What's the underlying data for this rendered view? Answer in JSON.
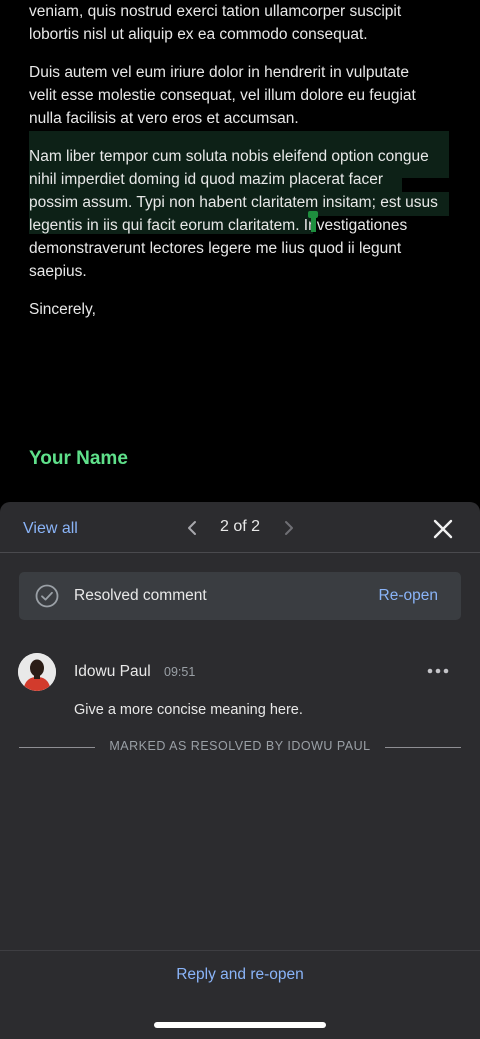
{
  "document": {
    "paragraphs": [
      [
        "veniam, quis nostrud exerci tation ullamcorper suscipit",
        "lobortis nisl ut aliquip ex ea commodo consequat."
      ],
      [
        "Duis autem vel eum iriure dolor in hendrerit in vulputate",
        "velit esse molestie consequat, vel illum dolore eu feugiat",
        "nulla facilisis at vero eros et accumsan."
      ],
      [
        "Nam liber tempor cum soluta nobis eleifend option congue",
        "nihil imperdiet doming id quod mazim placerat facer",
        "possim assum. Typi non habent claritatem insitam; est usus",
        "legentis in iis qui facit eorum claritatem. Investigationes",
        "demonstraverunt lectores legere me lius quod ii legunt",
        "saepius."
      ],
      [
        "Sincerely,"
      ]
    ],
    "signature": "Your Name"
  },
  "sheet": {
    "view_all": "View all",
    "pager": "2 of 2",
    "resolved_label": "Resolved comment",
    "reopen": "Re-open",
    "comment": {
      "author": "Idowu Paul",
      "time": "09:51",
      "text": "Give a more concise meaning here."
    },
    "resolved_by": "MARKED AS RESOLVED BY IDOWU PAUL",
    "reply_reopen": "Reply and re-open"
  },
  "colors": {
    "accent_link": "#8ab4f8",
    "signature": "#5fe08a",
    "highlight": "#0d2117",
    "cursor": "#1e8e3e",
    "sheet_bg": "#2c2c2f"
  },
  "icons": {
    "prev": "chevron-left-icon",
    "next": "chevron-right-icon",
    "close": "close-icon",
    "resolved": "check-circle-icon",
    "more": "more-horizontal-icon"
  }
}
